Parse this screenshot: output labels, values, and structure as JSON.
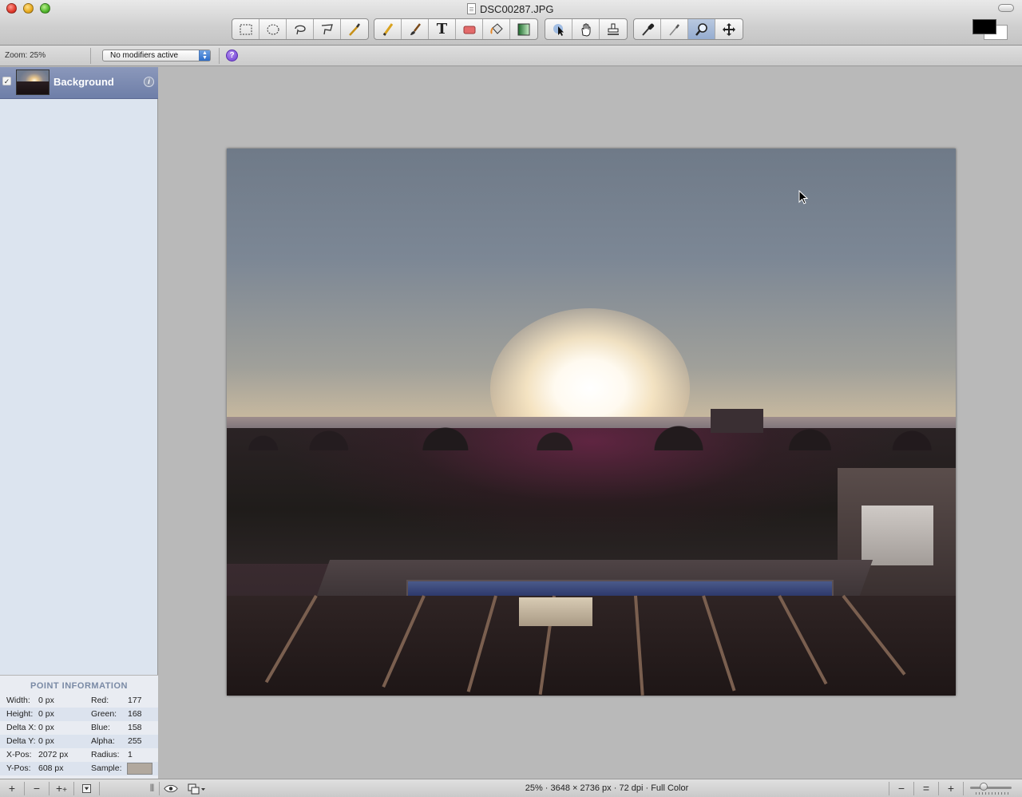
{
  "window": {
    "title": "DSC00287.JPG"
  },
  "toolbar": {
    "groups": [
      {
        "tools": [
          "rect-select-icon",
          "ellipse-select-icon",
          "lasso-icon",
          "polygon-lasso-icon",
          "magic-wand-icon"
        ]
      },
      {
        "tools": [
          "pencil-icon",
          "brush-icon",
          "text-icon",
          "eraser-icon",
          "paint-bucket-icon",
          "gradient-icon"
        ]
      },
      {
        "tools": [
          "pointer-icon",
          "hand-icon",
          "stamp-icon"
        ]
      },
      {
        "tools": [
          "eyedropper-icon",
          "smudge-icon",
          "zoom-icon",
          "move-icon"
        ]
      }
    ],
    "text_tool_glyph": "T",
    "active_tool": "zoom-icon",
    "foreground_color": "#000000",
    "background_color": "#ffffff"
  },
  "options_bar": {
    "zoom_label": "Zoom: 25%",
    "modifiers_select": "No modifiers active",
    "help_glyph": "?"
  },
  "layers": [
    {
      "name": "Background",
      "visible": true
    }
  ],
  "point_information": {
    "title": "POINT INFORMATION",
    "rows": [
      {
        "k1": "Width:",
        "v1": "0 px",
        "k2": "Red:",
        "v2": "177"
      },
      {
        "k1": "Height:",
        "v1": "0 px",
        "k2": "Green:",
        "v2": "168"
      },
      {
        "k1": "Delta X:",
        "v1": "0 px",
        "k2": "Blue:",
        "v2": "158"
      },
      {
        "k1": "Delta Y:",
        "v1": "0 px",
        "k2": "Alpha:",
        "v2": "255"
      },
      {
        "k1": "X-Pos:",
        "v1": "2072 px",
        "k2": "Radius:",
        "v2": "1"
      },
      {
        "k1": "Y-Pos:",
        "v1": "608 px",
        "k2": "Sample:",
        "v2": ""
      }
    ],
    "sample_color": "#b1a89e"
  },
  "status_bar": {
    "info": "25% · 3648 × 2736 px · 72 dpi · Full Color",
    "add_layer": "+",
    "remove_layer": "−",
    "duplicate_layer": "+",
    "zoom_out": "−",
    "zoom_actual": "=",
    "zoom_in": "+",
    "zoom_level": 0.25
  }
}
